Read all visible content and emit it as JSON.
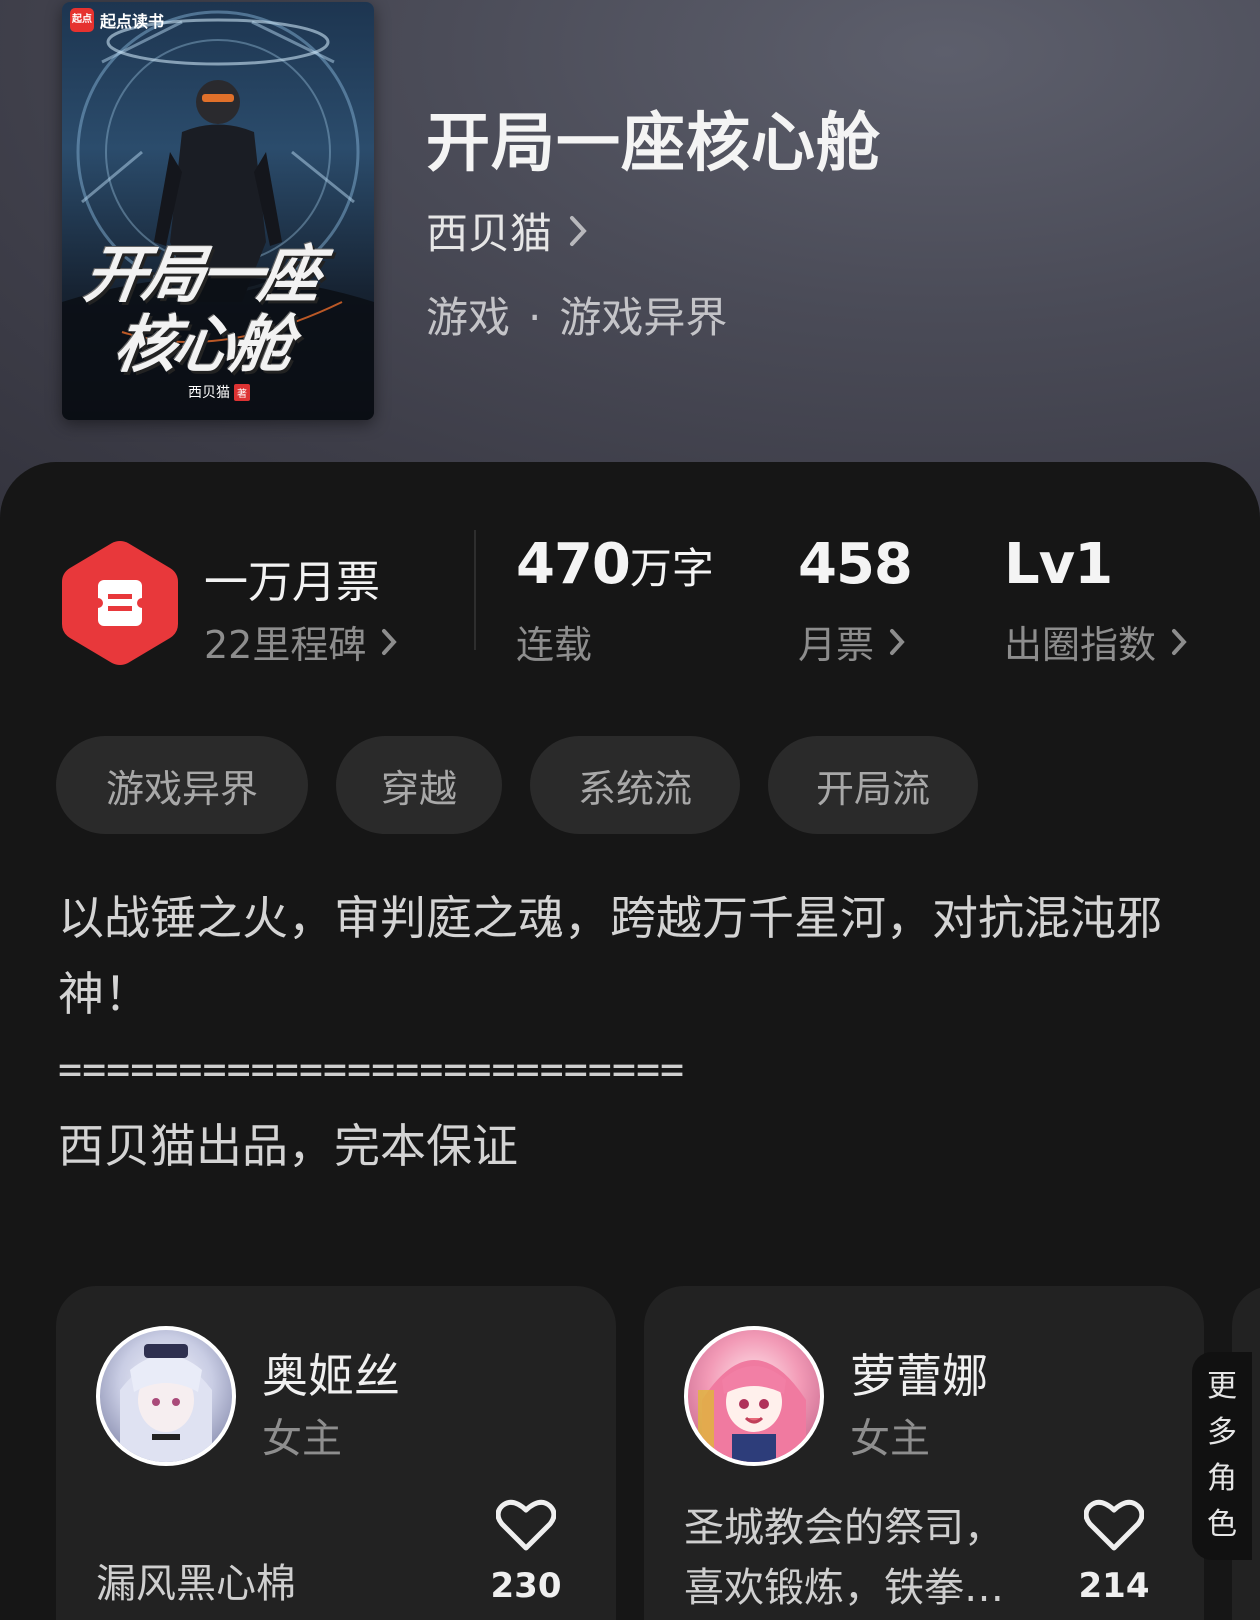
{
  "book": {
    "title": "开局一座核心舱",
    "author": "西贝猫",
    "category": "游戏",
    "subcategory": "游戏异界",
    "cover": {
      "brand": "起点读书",
      "brand_logo_text": "起点",
      "title_line1": "开局一座",
      "title_line2": "核心舱",
      "author": "西贝猫",
      "author_badge": "著"
    }
  },
  "stats": {
    "monthly_ticket_label": "一万月票",
    "milestone_label": "22里程碑",
    "word_count": "470",
    "word_unit": "万字",
    "status": "连载",
    "monthly_votes": "458",
    "monthly_votes_label": "月票",
    "level": "Lv1",
    "level_label": "出圈指数"
  },
  "tags": [
    "游戏异界",
    "穿越",
    "系统流",
    "开局流"
  ],
  "description": {
    "line1": "以战锤之火，审判庭之魂，跨越万千星河，对抗混沌邪神！",
    "separator": "==========================",
    "line2": "西贝猫出品，完本保证"
  },
  "characters": [
    {
      "name": "奥姬丝",
      "role": "女主",
      "desc": "漏风黑心棉",
      "likes": "230"
    },
    {
      "name": "萝蕾娜",
      "role": "女主",
      "desc": "圣城教会的祭司，喜欢锻炼，铁拳…",
      "likes": "214"
    }
  ],
  "more_characters": "更多角色",
  "colors": {
    "accent_red": "#e8383b",
    "panel_bg": "#161616",
    "card_bg": "#222222",
    "tag_bg": "#2a2a2a"
  },
  "icons": [
    "chevron-right-icon",
    "ticket-icon",
    "heart-icon"
  ]
}
